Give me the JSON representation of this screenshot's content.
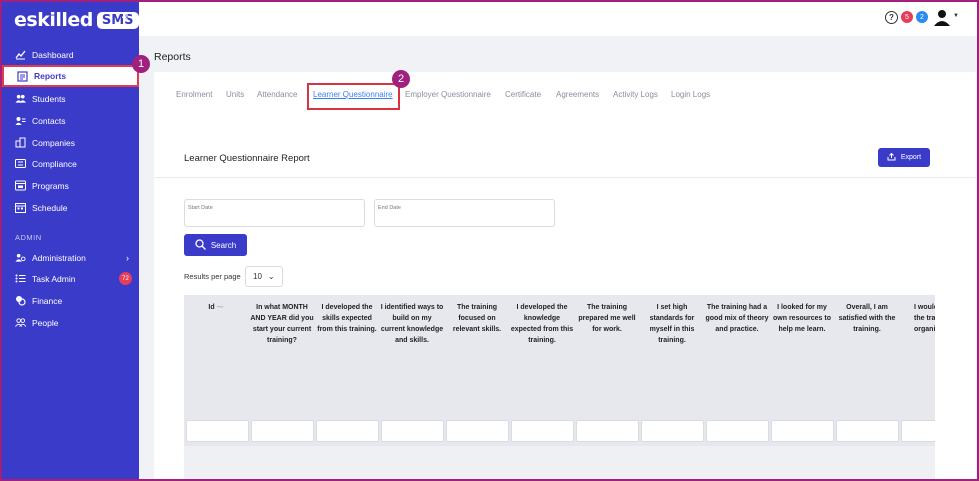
{
  "sidebar": {
    "logo_text": "eskilled",
    "logo_badge": "SMS",
    "collapse": "«",
    "items": [
      {
        "label": "Dashboard",
        "icon": "chart-icon"
      },
      {
        "label": "Reports",
        "icon": "report-icon"
      },
      {
        "label": "Students",
        "icon": "users-icon"
      },
      {
        "label": "Contacts",
        "icon": "contact-icon"
      },
      {
        "label": "Companies",
        "icon": "building-icon"
      },
      {
        "label": "Compliance",
        "icon": "compliance-icon"
      },
      {
        "label": "Programs",
        "icon": "programs-icon"
      },
      {
        "label": "Schedule",
        "icon": "calendar-icon"
      }
    ],
    "section_admin": "ADMIN",
    "admin_items": [
      {
        "label": "Administration",
        "icon": "admin-icon"
      },
      {
        "label": "Task Admin",
        "icon": "list-icon",
        "badge": "72"
      },
      {
        "label": "Finance",
        "icon": "coins-icon"
      },
      {
        "label": "People",
        "icon": "people-icon"
      }
    ]
  },
  "annotations": {
    "step1": "1",
    "step2": "2"
  },
  "topbar": {
    "help": "?",
    "badge_red": "5",
    "badge_blue": "2"
  },
  "page": {
    "title": "Reports",
    "tabs": [
      "Enrolment",
      "Units",
      "Attendance",
      "Learner Questionnaire",
      "Employer Questionnaire",
      "Certificate",
      "Agreements",
      "Activity Logs",
      "Login Logs"
    ],
    "active_tab": "Learner Questionnaire"
  },
  "report": {
    "title": "Learner Questionnaire Report",
    "export_label": "Export",
    "start_date_placeholder": "Start Date",
    "end_date_placeholder": "End Date",
    "search_label": "Search",
    "rpp_label": "Results per page",
    "rpp_value": "10",
    "columns": [
      "Id",
      "In what MONTH AND YEAR did you start your current training?",
      "I developed the skills expected from this training.",
      "I identified ways to build on my current knowledge and skills.",
      "The training focused on relevant skills.",
      "I developed the knowledge expected from this training.",
      "The training prepared me well for work.",
      "I set high standards for myself in this training.",
      "The training had a good mix of theory and practice.",
      "I looked for my own resources to help me learn.",
      "Overall, I am satisfied with the training.",
      "I would recommend the training organisation to others"
    ]
  },
  "colors": {
    "sidebar": "#3b3bc9",
    "primary": "#3b3bc9",
    "tab_active": "#3b82f6",
    "annotation": "#a0207e",
    "highlight_border": "#d9333f",
    "badge_red": "#e53e5a",
    "badge_blue": "#2a8cf0"
  }
}
